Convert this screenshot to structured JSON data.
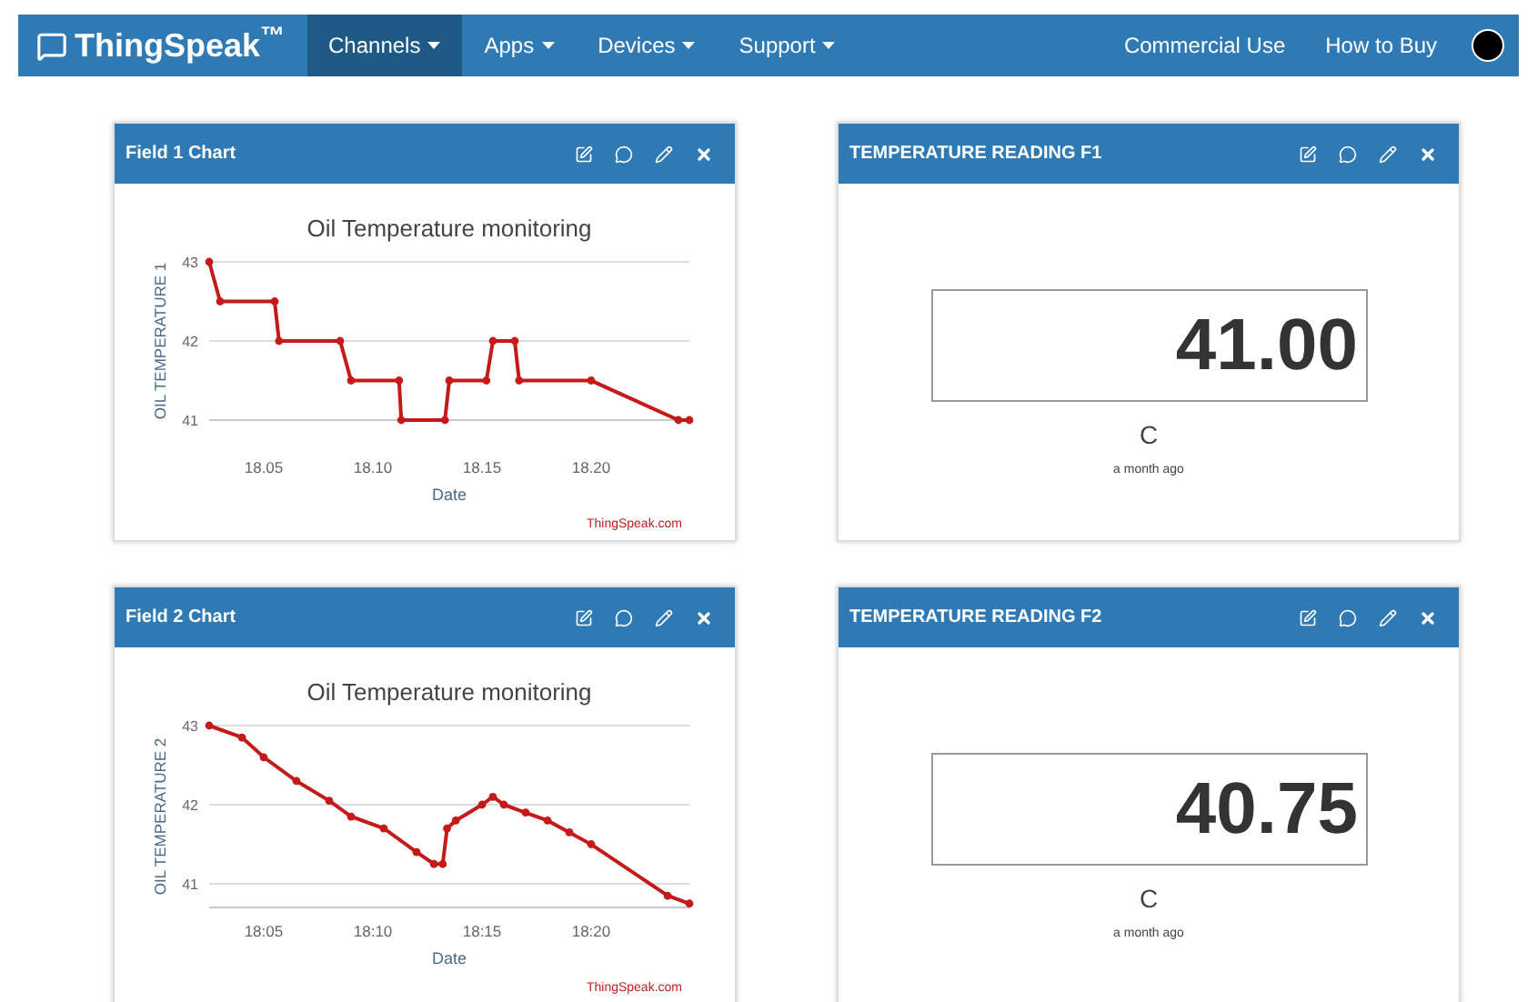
{
  "navbar": {
    "brand": "ThingSpeak",
    "brand_mark": "™",
    "menu": [
      {
        "label": "Channels",
        "selected": true,
        "dropdown": true
      },
      {
        "label": "Apps",
        "selected": false,
        "dropdown": true
      },
      {
        "label": "Devices",
        "selected": false,
        "dropdown": true
      },
      {
        "label": "Support",
        "selected": false,
        "dropdown": true
      }
    ],
    "right_links": [
      "Commercial Use",
      "How to Buy"
    ]
  },
  "cards": [
    {
      "kind": "chart",
      "title": "Field 1 Chart",
      "credit": "ThingSpeak.com",
      "chart_data": {
        "type": "line",
        "title": "Oil Temperature monitoring",
        "xlabel": "Date",
        "ylabel": "OIL TEMPERATURE 1",
        "x": [
          18.025,
          18.03,
          18.055,
          18.057,
          18.085,
          18.09,
          18.112,
          18.113,
          18.133,
          18.135,
          18.152,
          18.155,
          18.165,
          18.167,
          18.2,
          18.24,
          18.245
        ],
        "series": [
          {
            "color": "#c41a1a",
            "marker": true,
            "values": [
              43,
              42.5,
              42.5,
              42,
              42,
              41.5,
              41.5,
              41,
              41,
              41.5,
              41.5,
              42,
              42,
              41.5,
              41.5,
              41,
              41
            ]
          }
        ],
        "xlim": [
          18.025,
          18.245
        ],
        "ylim": [
          41,
          43
        ],
        "grid": true,
        "xticks": [
          {
            "value": 18.05,
            "label": "18.05"
          },
          {
            "value": 18.1,
            "label": "18.10"
          },
          {
            "value": 18.15,
            "label": "18.15"
          },
          {
            "value": 18.2,
            "label": "18.20"
          }
        ],
        "yticks": [
          41,
          42,
          43
        ]
      }
    },
    {
      "kind": "reading",
      "title": "TEMPERATURE READING F1",
      "value": "41.00",
      "unit": "C",
      "time": "a month ago"
    },
    {
      "kind": "chart",
      "title": "Field 2 Chart",
      "credit": "ThingSpeak.com",
      "chart_data": {
        "type": "line",
        "title": "Oil Temperature monitoring",
        "xlabel": "Date",
        "ylabel": "OIL TEMPERATURE 2",
        "x": [
          18.0417,
          18.0667,
          18.0833,
          18.1083,
          18.1333,
          18.15,
          18.175,
          18.2,
          18.2133,
          18.22,
          18.2233,
          18.23,
          18.25,
          18.2583,
          18.2667,
          18.2833,
          18.3,
          18.3167,
          18.3333,
          18.3917,
          18.4083
        ],
        "series": [
          {
            "color": "#c41a1a",
            "marker": true,
            "values": [
              43,
              42.85,
              42.6,
              42.3,
              42.05,
              41.85,
              41.7,
              41.4,
              41.25,
              41.25,
              41.7,
              41.8,
              42,
              42.1,
              42,
              41.9,
              41.8,
              41.65,
              41.5,
              40.85,
              40.75
            ]
          }
        ],
        "xlim": [
          18.0417,
          18.4083
        ],
        "ylim": [
          40.7,
          43
        ],
        "grid": true,
        "xticks": [
          {
            "value": 18.0833,
            "label": "18:05"
          },
          {
            "value": 18.1667,
            "label": "18:10"
          },
          {
            "value": 18.25,
            "label": "18:15"
          },
          {
            "value": 18.3333,
            "label": "18:20"
          }
        ],
        "yticks": [
          41,
          42,
          43
        ]
      }
    },
    {
      "kind": "reading",
      "title": "TEMPERATURE READING F2",
      "value": "40.75",
      "unit": "C",
      "time": "a month ago"
    }
  ]
}
